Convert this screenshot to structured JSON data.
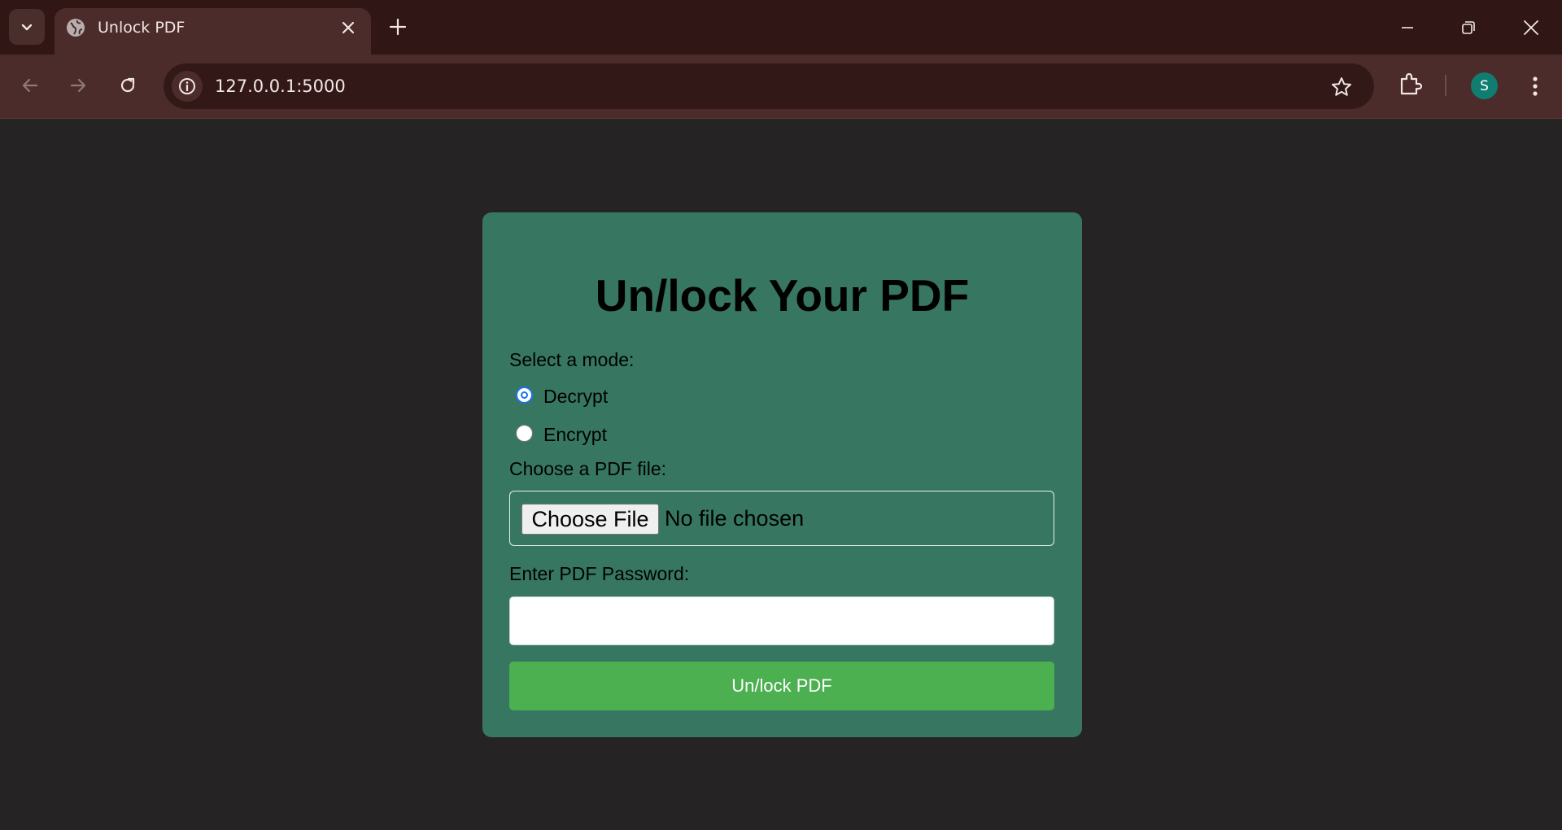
{
  "browser": {
    "tab_title": "Unlock PDF",
    "url": "127.0.0.1:5000",
    "profile_initial": "S",
    "icons": {
      "tab_search": "chevron-down-icon",
      "favicon": "globe-icon",
      "tab_close": "close-icon",
      "new_tab": "plus-icon",
      "back": "arrow-left-icon",
      "forward": "arrow-right-icon",
      "reload": "reload-icon",
      "site_info": "info-icon",
      "bookmark": "star-icon",
      "extensions": "puzzle-icon",
      "menu": "kebab-menu-icon"
    }
  },
  "page": {
    "title": "Un/lock Your PDF",
    "mode_label": "Select a mode:",
    "modes": [
      {
        "label": "Decrypt",
        "checked": true
      },
      {
        "label": "Encrypt",
        "checked": false
      }
    ],
    "file_label": "Choose a PDF file:",
    "file_button": "Choose File",
    "file_status": "No file chosen",
    "password_label": "Enter PDF Password:",
    "password_value": "",
    "submit_label": "Un/lock PDF"
  },
  "colors": {
    "page_background": "#252323",
    "card_background": "#377761",
    "button_green": "#4caf50",
    "browser_frame": "#301716",
    "browser_toolbar": "#4b2c2b",
    "radio_accent": "#1a73e8"
  }
}
